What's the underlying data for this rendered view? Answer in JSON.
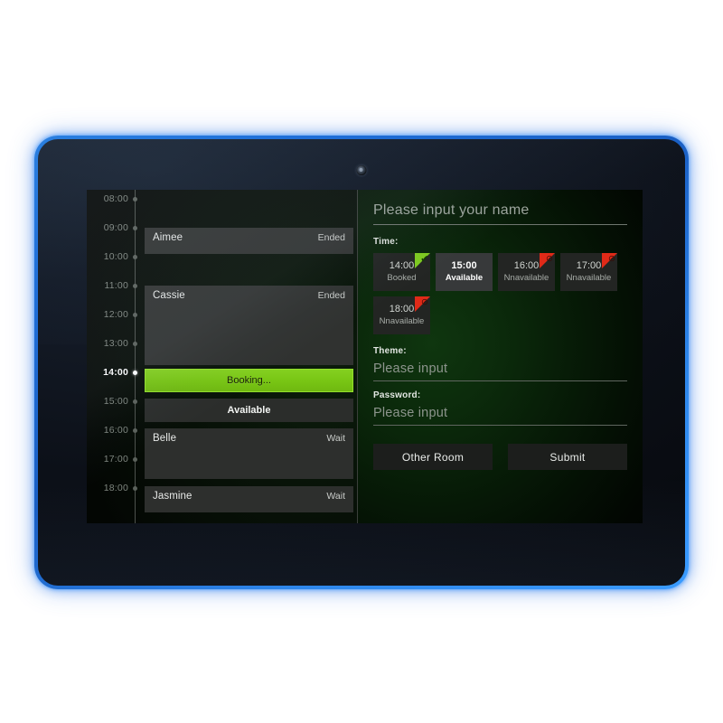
{
  "device": {
    "frame_color": "#2a7fe0",
    "camera_icon": "camera-lens"
  },
  "schedule": {
    "times": [
      "08:00",
      "09:00",
      "10:00",
      "11:00",
      "12:00",
      "13:00",
      "14:00",
      "15:00",
      "16:00",
      "17:00",
      "18:00"
    ],
    "active_time": "14:00",
    "events": [
      {
        "name": "Aimee",
        "status": "Ended",
        "kind": "ended"
      },
      {
        "name": "Cassie",
        "status": "Ended",
        "kind": "ended"
      },
      {
        "name": "",
        "status": "Booking...",
        "kind": "booking"
      },
      {
        "name": "",
        "status": "Available",
        "kind": "available"
      },
      {
        "name": "Belle",
        "status": "Wait",
        "kind": "wait"
      },
      {
        "name": "Jasmine",
        "status": "Wait",
        "kind": "wait"
      }
    ]
  },
  "form": {
    "name_placeholder": "Please input your name",
    "time_label": "Time:",
    "slots": [
      {
        "hour": "14:00",
        "status": "Booked",
        "state": "booked"
      },
      {
        "hour": "15:00",
        "status": "Available",
        "state": "selected"
      },
      {
        "hour": "16:00",
        "status": "Nnavailable",
        "state": "unavailable"
      },
      {
        "hour": "17:00",
        "status": "Nnavailable",
        "state": "unavailable"
      },
      {
        "hour": "18:00",
        "status": "Nnavailable",
        "state": "unavailable"
      }
    ],
    "slot_ok_glyph": "✔",
    "slot_no_glyph": "⊘",
    "theme_label": "Theme:",
    "theme_placeholder": "Please input",
    "password_label": "Password:",
    "password_placeholder": "Please input",
    "other_room_label": "Other  Room",
    "submit_label": "Submit"
  },
  "colors": {
    "accent_green": "#78c514",
    "deny_red": "#e02a18",
    "frame_blue": "#2a7fe0"
  }
}
